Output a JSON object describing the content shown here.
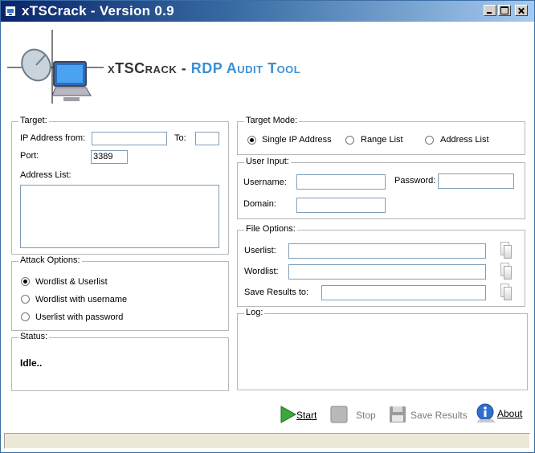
{
  "window": {
    "title": "xTSCrack - Version 0.9"
  },
  "brand": {
    "name": "xTSCrack",
    "separator": " - ",
    "subtitle": "RDP Audit Tool"
  },
  "target": {
    "legend": "Target:",
    "ip_from_label": "IP Address from:",
    "ip_from_value": "",
    "to_label": "To:",
    "to_value": "",
    "port_label": "Port:",
    "port_value": "3389",
    "address_list_label": "Address List:"
  },
  "attack": {
    "legend": "Attack Options:",
    "options": [
      {
        "label": "Wordlist & Userlist",
        "selected": true
      },
      {
        "label": "Wordlist with username",
        "selected": false
      },
      {
        "label": "Userlist with password",
        "selected": false
      }
    ]
  },
  "status": {
    "legend": "Status:",
    "text": "Idle.."
  },
  "target_mode": {
    "legend": "Target Mode:",
    "options": [
      {
        "label": "Single IP Address",
        "selected": true
      },
      {
        "label": "Range List",
        "selected": false
      },
      {
        "label": "Address List",
        "selected": false
      }
    ]
  },
  "user_input": {
    "legend": "User Input:",
    "username_label": "Username:",
    "password_label": "Password:",
    "domain_label": "Domain:"
  },
  "file_options": {
    "legend": "File Options:",
    "userlist_label": "Userlist:",
    "wordlist_label": "Wordlist:",
    "save_results_label": "Save Results to:"
  },
  "log": {
    "legend": "Log:"
  },
  "buttons": {
    "start": "Start",
    "stop": "Stop",
    "save_results": "Save Results",
    "about": "About"
  },
  "colors": {
    "brand_accent": "#3d8fd4",
    "title_bar": "#0a246a"
  }
}
